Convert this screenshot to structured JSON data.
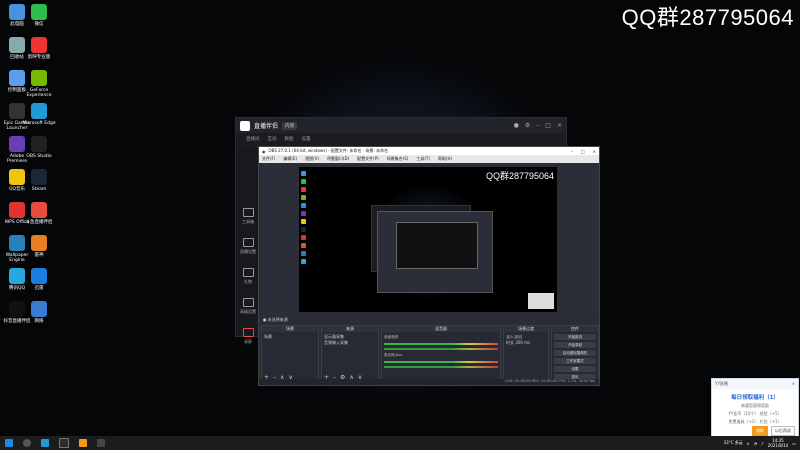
{
  "watermark": "QQ群287795064",
  "desktop_icons": [
    {
      "label": "此电脑",
      "color": "#4a90e2"
    },
    {
      "label": "微信",
      "color": "#2dbd4e"
    },
    {
      "label": "回收站",
      "color": "#8aa"
    },
    {
      "label": "剪映专业版",
      "color": "#e33"
    },
    {
      "label": "控制面板",
      "color": "#5aa0e8"
    },
    {
      "label": "GeForce Experience",
      "color": "#76b900"
    },
    {
      "label": "Epic Games Launcher",
      "color": "#333"
    },
    {
      "label": "Microsoft Edge",
      "color": "#1e9ad6"
    },
    {
      "label": "Adobe Premiere",
      "color": "#6a3db8"
    },
    {
      "label": "OBS Studio",
      "color": "#222"
    },
    {
      "label": "QQ音乐",
      "color": "#f1c40f"
    },
    {
      "label": "Steam",
      "color": "#1b2838"
    },
    {
      "label": "WPS Office",
      "color": "#d33"
    },
    {
      "label": "斗鱼直播伴侣",
      "color": "#e74c3c"
    },
    {
      "label": "Wallpaper Engine",
      "color": "#2980b9"
    },
    {
      "label": "雷神",
      "color": "#e67e22"
    },
    {
      "label": "腾讯QQ",
      "color": "#2aa6e0"
    },
    {
      "label": "迅雷",
      "color": "#1a7de0"
    },
    {
      "label": "抖音直播伴侣",
      "color": "#111"
    },
    {
      "label": "网络",
      "color": "#3a7bd5"
    }
  ],
  "client": {
    "title": "直播伴侣",
    "tag": "内测",
    "tabs": [
      "直播间",
      "互动",
      "数据",
      "设置"
    ],
    "side_items": [
      "工具箱",
      "直播设置",
      "礼物",
      "高级设置",
      "录屏"
    ]
  },
  "obs": {
    "title": "OBS 27.0.1 (64-bit, windows) - 配置文件: 未命名 - 场景: 未命名",
    "menus": [
      "文件(F)",
      "编辑(E)",
      "视图(V)",
      "停靠窗口(D)",
      "配置文件(P)",
      "场景集合(S)",
      "工具(T)",
      "帮助(H)"
    ],
    "preview_watermark": "QQ群287795064",
    "docks": {
      "scenes": {
        "title": "场景",
        "items": [
          "场景"
        ]
      },
      "sources": {
        "title": "来源",
        "items": [
          "显示器采集",
          "音频输入采集"
        ]
      },
      "mixer": {
        "title": "混音器",
        "tracks": [
          "桌面音频",
          "麦克风/Aux"
        ]
      },
      "transitions": {
        "title": "场景过渡",
        "items": [
          "淡入淡出",
          "时长 300 ms"
        ]
      },
      "controls": {
        "title": "控件",
        "buttons": [
          "开始推流",
          "开始录制",
          "启动虚拟摄像机",
          "工作室模式",
          "设置",
          "退出"
        ]
      }
    },
    "status": "LIVE: 00:00:00  REC: 00:00:00  CPU: 2.1%, 30.00 fps"
  },
  "toast": {
    "app": "YY直播",
    "title": "每日领取福利（1）",
    "lines": [
      "恭喜您获得奖励",
      "YY金币（10个）  经验（+5）",
      "免费道具（+1）  礼包（+1）"
    ],
    "btn_primary": "领取",
    "btn_secondary": "以后再说"
  },
  "taskbar": {
    "weather": "33°C 多云",
    "time": "14:35",
    "date": "2021/8/14"
  }
}
